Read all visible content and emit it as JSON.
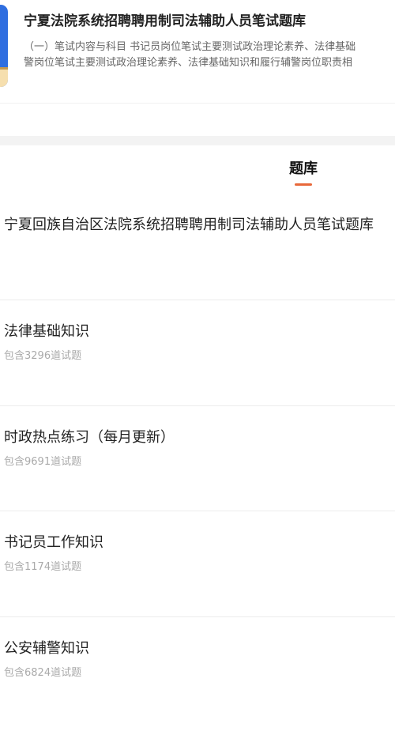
{
  "header": {
    "title": "宁夏法院系统招聘聘用制司法辅助人员笔试题库",
    "description_lines": [
      "（一）笔试内容与科目 书记员岗位笔试主要测试政治理论素养、法律基础",
      "警岗位笔试主要测试政治理论素养、法律基础知识和履行辅警岗位职责相"
    ],
    "icon": "book-icon"
  },
  "tab": {
    "label": "题库",
    "accent_color": "#e8683a"
  },
  "bank_title": "宁夏回族自治区法院系统招聘聘用制司法辅助人员笔试题库",
  "items": [
    {
      "title": "法律基础知识",
      "count": "包含3296道试题"
    },
    {
      "title": "时政热点练习（每月更新）",
      "count": "包含9691道试题"
    },
    {
      "title": "书记员工作知识",
      "count": "包含1174道试题"
    },
    {
      "title": "公安辅警知识",
      "count": "包含6824道试题"
    }
  ]
}
